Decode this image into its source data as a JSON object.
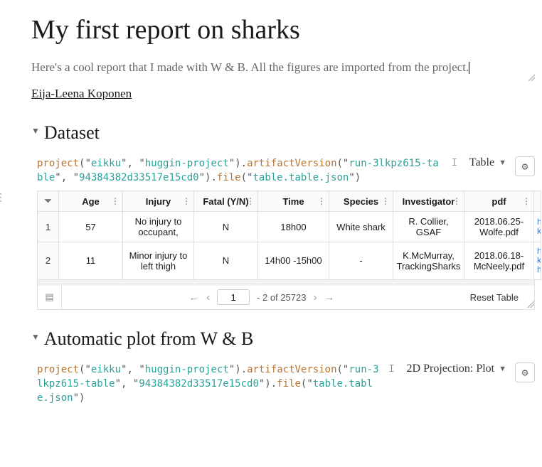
{
  "title": "My first report on sharks",
  "subtitle": "Here's a cool report that I made with W & B. All the figures are imported from the project.",
  "author": "Eija-Leena Koponen",
  "sections": {
    "dataset": {
      "title": "Dataset",
      "view_label": "Table",
      "query": {
        "fn1": "project",
        "arg1a": "eikku",
        "arg1b": "huggin-project",
        "fn2": "artifactVersion",
        "arg2a": "run-3lkpz615-table",
        "arg2b": "94384382d33517e15cd0",
        "fn3": "file",
        "arg3": "table.table.json"
      },
      "table": {
        "headers": {
          "age": "Age",
          "injury": "Injury",
          "fatal": "Fatal (Y/N)",
          "time": "Time",
          "species": "Species",
          "investigator": "Investigator",
          "pdf": "pdf"
        },
        "rows": [
          {
            "idx": "1",
            "age": "57",
            "injury": "No injury to occupant,",
            "fatal": "N",
            "time": "18h00",
            "species": "White shark",
            "investigator": "R. Collier, GSAF",
            "pdf": "2018.06.25-Wolfe.pdf",
            "href": "h\nk"
          },
          {
            "idx": "2",
            "age": "11",
            "injury": "Minor injury to left thigh",
            "fatal": "N",
            "time": "14h00 -15h00",
            "species": "-",
            "investigator": "K.McMurray, TrackingSharks",
            "pdf": "2018.06.18-McNeely.pdf",
            "href": "h\nk\nh"
          }
        ],
        "pager": {
          "current": "1",
          "range_text": "- 2 of 25723",
          "reset": "Reset Table"
        }
      }
    },
    "plot": {
      "title": "Automatic plot from W & B",
      "view_label": "2D Projection: Plot",
      "query": {
        "fn1": "project",
        "arg1a": "eikku",
        "arg1b": "huggin-project",
        "fn2": "artifactVersion",
        "arg2a": "run-3lkpz615-table",
        "arg2b": "94384382d33517e15cd0",
        "fn3": "file",
        "arg3": "table.table.json"
      }
    }
  }
}
